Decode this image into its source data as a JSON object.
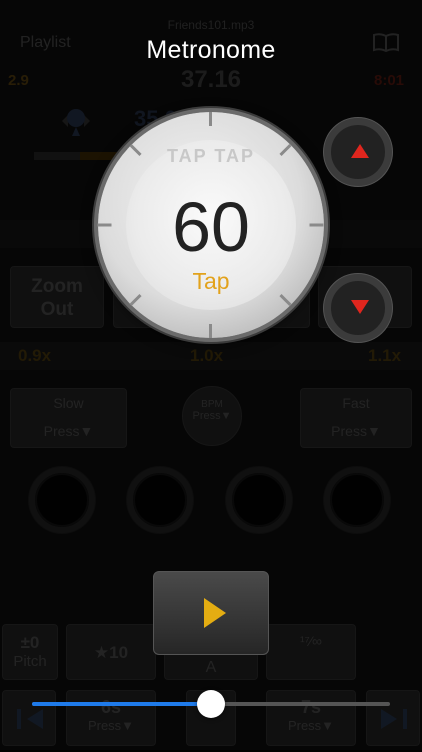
{
  "header": {
    "playlist_label": "Playlist",
    "filename": "Friends101.mp3",
    "time_center": "37.16",
    "left_value": "2.9",
    "right_value": "8:01",
    "position_value": "35.09"
  },
  "metronome": {
    "title": "Metronome",
    "bpm": "60",
    "tap_label": "Tap",
    "dial_text": "TAP TAP"
  },
  "controls": {
    "zoom_out_label": "Zoom\nOut",
    "speed_min": "0.9x",
    "speed_center": "1.0x",
    "speed_max": "1.1x",
    "slow_label": "Slow",
    "slow_sub": "Press▼",
    "fast_label": "Fast",
    "fast_sub": "Press▼",
    "bpm_label": "BPM",
    "bpm_sub": "Press▼",
    "a_label": "A"
  },
  "bottom": {
    "pitch_value": "±0",
    "pitch_label": "Pitch",
    "star_label": "★10",
    "fraction_label": "¹⁷⁄∞",
    "back_label": "6s",
    "back_sub": "Press▼",
    "fwd_label": "7s",
    "fwd_sub": "Press▼"
  },
  "slider": {
    "value": 0.5
  },
  "colors": {
    "accent": "#e2a21c",
    "arrow": "#e0261e",
    "slider": "#1f7bea"
  }
}
